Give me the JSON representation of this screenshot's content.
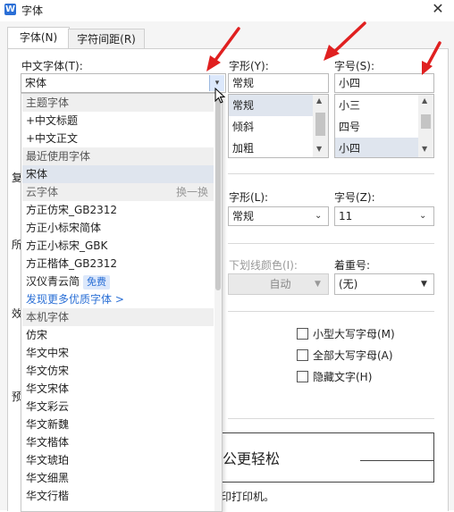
{
  "window": {
    "title": "字体",
    "app_icon": "W"
  },
  "tabs": [
    {
      "label": "字体(N)"
    },
    {
      "label": "字符间距(R)"
    }
  ],
  "chinese_font": {
    "label": "中文字体(T):",
    "value": "宋体"
  },
  "font_style": {
    "label": "字形(Y):",
    "value": "常规",
    "options": [
      "常规",
      "倾斜",
      "加粗"
    ],
    "selected_index": 0
  },
  "font_size": {
    "label": "字号(S):",
    "value": "小四",
    "options": [
      "小三",
      "四号",
      "小四"
    ],
    "selected_index": 2
  },
  "font_style_latin": {
    "label": "字形(L):",
    "value": "常规"
  },
  "font_size_latin": {
    "label": "字号(Z):",
    "value": "11"
  },
  "underline_color": {
    "label": "下划线颜色(I):",
    "value": "自动"
  },
  "emphasis": {
    "label": "着重号:",
    "value": "(无)"
  },
  "effects": [
    {
      "label": "小型大写字母(M)",
      "checked": false
    },
    {
      "label": "全部大写字母(A)",
      "checked": false
    },
    {
      "label": "隐藏文字(H)",
      "checked": false
    }
  ],
  "preview": {
    "text": "办公更轻松",
    "note": "印打印机。"
  },
  "left_partial_labels": [
    "复",
    "所",
    "效",
    "预"
  ],
  "font_dropdown": {
    "items": [
      {
        "kind": "header",
        "label": "主题字体"
      },
      {
        "kind": "item",
        "label": "+中文标题"
      },
      {
        "kind": "item",
        "label": "+中文正文"
      },
      {
        "kind": "header",
        "label": "最近使用字体"
      },
      {
        "kind": "selected",
        "label": "宋体"
      },
      {
        "kind": "header",
        "label": "云字体",
        "action": "换一换"
      },
      {
        "kind": "item",
        "label": "方正仿宋_GB2312"
      },
      {
        "kind": "item",
        "label": "方正小标宋简体"
      },
      {
        "kind": "item",
        "label": "方正小标宋_GBK"
      },
      {
        "kind": "item",
        "label": "方正楷体_GB2312"
      },
      {
        "kind": "item",
        "label": "汉仪青云简",
        "badge": "免费"
      },
      {
        "kind": "link",
        "label": "发现更多优质字体 >"
      },
      {
        "kind": "header",
        "label": "本机字体"
      },
      {
        "kind": "item",
        "label": "仿宋"
      },
      {
        "kind": "item",
        "label": "华文中宋"
      },
      {
        "kind": "item",
        "label": "华文仿宋"
      },
      {
        "kind": "item",
        "label": "华文宋体"
      },
      {
        "kind": "item",
        "label": "华文彩云"
      },
      {
        "kind": "item",
        "label": "华文新魏"
      },
      {
        "kind": "item",
        "label": "华文楷体"
      },
      {
        "kind": "item",
        "label": "华文琥珀"
      },
      {
        "kind": "item",
        "label": "华文细黑"
      },
      {
        "kind": "item",
        "label": "华文行楷"
      }
    ]
  },
  "colors": {
    "accent": "#2a6fd6",
    "annotation_arrow": "#e02020",
    "selected_bg": "#dfe5ee"
  }
}
